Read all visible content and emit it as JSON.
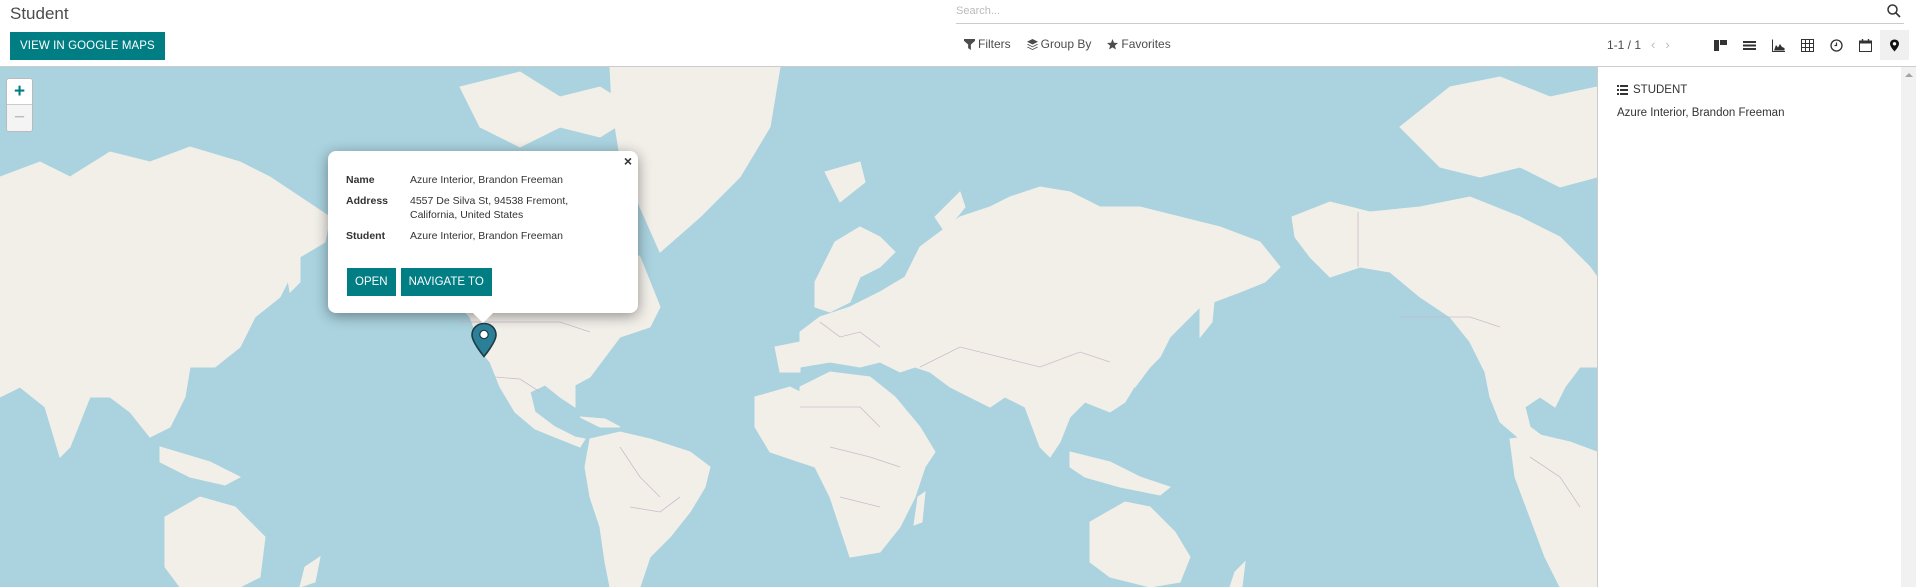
{
  "header": {
    "title": "Student",
    "google_maps_button": "VIEW IN GOOGLE MAPS",
    "search_placeholder": "Search...",
    "filters": [
      {
        "label": "Filters",
        "icon": "filter-icon"
      },
      {
        "label": "Group By",
        "icon": "layers-icon"
      },
      {
        "label": "Favorites",
        "icon": "star-icon"
      }
    ],
    "pager": {
      "value": "1-1 / 1"
    },
    "views": [
      {
        "name": "kanban",
        "icon": "kanban-icon",
        "active": false
      },
      {
        "name": "list",
        "icon": "list-icon",
        "active": false
      },
      {
        "name": "graph",
        "icon": "area-chart-icon",
        "active": false
      },
      {
        "name": "pivot",
        "icon": "table-icon",
        "active": false
      },
      {
        "name": "activity",
        "icon": "clock-icon",
        "active": false
      },
      {
        "name": "calendar",
        "icon": "calendar-icon",
        "active": false
      },
      {
        "name": "map",
        "icon": "map-marker-icon",
        "active": true
      }
    ]
  },
  "map": {
    "zoom_in": "+",
    "zoom_out": "−",
    "colors": {
      "water": "#aad3df",
      "land": "#f2efe9",
      "border": "#c9b6c9",
      "marker": "#2b7f96"
    },
    "popup": {
      "close": "×",
      "fields": [
        {
          "label": "Name",
          "value": "Azure Interior, Brandon Freeman"
        },
        {
          "label": "Address",
          "value": "4557 De Silva St, 94538 Fremont, California, United States"
        },
        {
          "label": "Student",
          "value": "Azure Interior, Brandon Freeman"
        }
      ],
      "open_button": "OPEN",
      "navigate_button": "NAVIGATE TO"
    }
  },
  "panel": {
    "title": "STUDENT",
    "items": [
      "Azure Interior, Brandon Freeman"
    ]
  },
  "theme": {
    "primary": "#017e84"
  }
}
